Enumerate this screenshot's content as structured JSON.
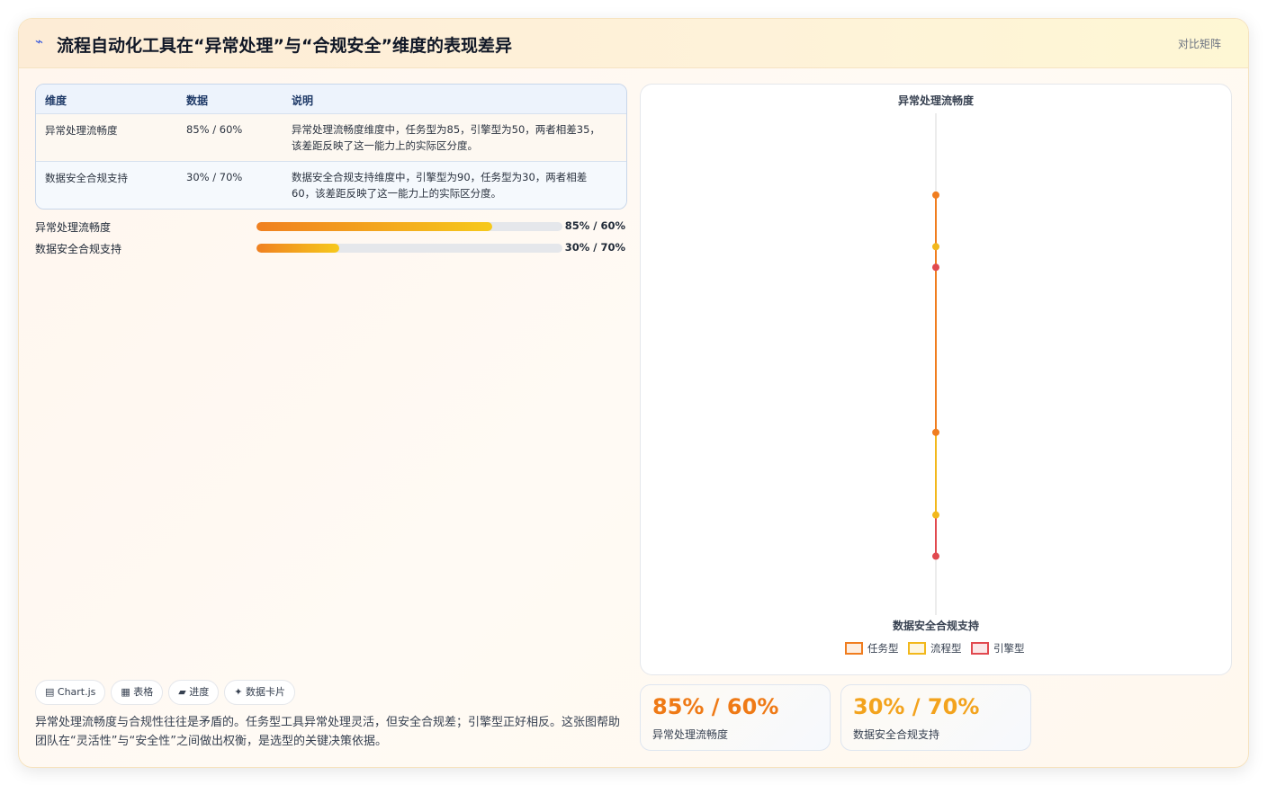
{
  "header": {
    "title": "流程自动化工具在“异常处理”与“合规安全”维度的表现差异",
    "tag": "对比矩阵",
    "icon": "lightning-icon"
  },
  "table": {
    "columns": [
      "维度",
      "数据",
      "说明"
    ],
    "rows": [
      {
        "dimension": "异常处理流畅度",
        "data": "85% / 60%",
        "note": "异常处理流畅度维度中，任务型为85，引擎型为50，两者相差35，该差距反映了这一能力上的实际区分度。"
      },
      {
        "dimension": "数据安全合规支持",
        "data": "30% / 70%",
        "note": "数据安全合规支持维度中，引擎型为90，任务型为30，两者相差60，该差距反映了这一能力上的实际区分度。"
      }
    ]
  },
  "progress": [
    {
      "label": "异常处理流畅度",
      "value_text": "85% / 60%",
      "fill": 0.77
    },
    {
      "label": "数据安全合规支持",
      "value_text": "30% / 70%",
      "fill": 0.27
    }
  ],
  "chips": [
    "▤ Chart.js",
    "▦ 表格",
    "▰ 进度",
    "✦ 数据卡片"
  ],
  "summary": "异常处理流畅度与合规性往往是矛盾的。任务型工具异常处理灵活，但安全合规差；引擎型正好相反。这张图帮助团队在“灵活性”与“安全性”之间做出权衡，是选型的关键决策依据。",
  "stats": [
    {
      "value": "85% / 60%",
      "label": "异常处理流畅度",
      "color": "#ef7a16"
    },
    {
      "value": "30% / 70%",
      "label": "数据安全合规支持",
      "color": "#f3a31d"
    }
  ],
  "chart_data": {
    "type": "radar",
    "axes": [
      "异常处理流畅度",
      "数据安全合规支持"
    ],
    "range": [
      0,
      100
    ],
    "series": [
      {
        "name": "任务型",
        "values": [
          85,
          30
        ],
        "color": "#f07d1f"
      },
      {
        "name": "流程型",
        "values": [
          60,
          70
        ],
        "color": "#f2b81c"
      },
      {
        "name": "引擎型",
        "values": [
          50,
          90
        ],
        "color": "#e1494f"
      }
    ],
    "legend_position": "bottom"
  }
}
